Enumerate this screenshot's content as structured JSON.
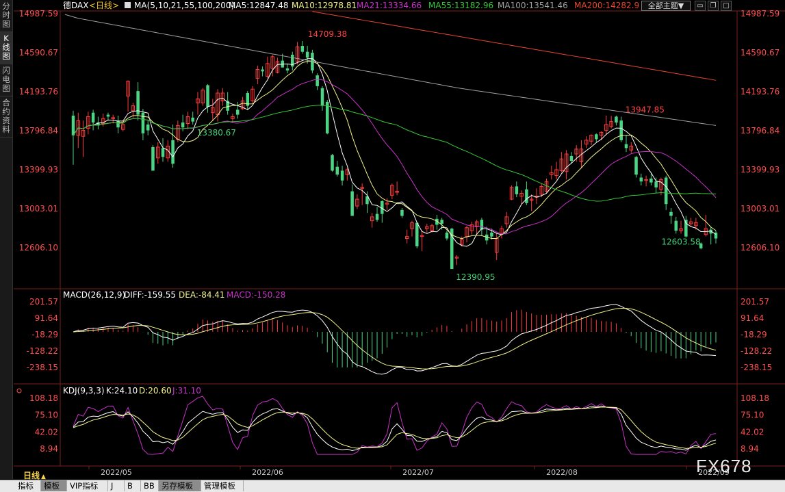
{
  "sidebar": {
    "tabs": [
      {
        "label": "分时图",
        "active": false
      },
      {
        "label": "K线图",
        "active": true
      },
      {
        "label": "闪电图",
        "active": false
      },
      {
        "label": "合约资料",
        "active": false
      }
    ]
  },
  "header": {
    "symbol": "德DAX",
    "period": "<日线>",
    "ma_title": "MA(5,10,21,55,100,200)",
    "ma5": "MA5:12847.48",
    "ma10": "MA10:12978.81",
    "ma21": "MA21:13334.66",
    "ma55": "MA55:13182.96",
    "ma100": "MA100:13541.46",
    "ma200": "MA200:14282.9",
    "theme_button": "全部主题▼",
    "colors": {
      "ma5": "#ffffff",
      "ma10": "#f4f48c",
      "ma21": "#c832c8",
      "ma55": "#36c836",
      "ma100": "#a0a0a0",
      "ma200": "#e8462d"
    }
  },
  "price_axis": [
    "14987.59",
    "14590.67",
    "14193.76",
    "13796.84",
    "13399.93",
    "13003.01",
    "12606.10"
  ],
  "annotations": [
    {
      "text": "14709.38",
      "color": "#ff4444"
    },
    {
      "text": "13380.67",
      "color": "#46d278"
    },
    {
      "text": "12390.95",
      "color": "#46d278"
    },
    {
      "text": "13947.85",
      "color": "#ff4444"
    },
    {
      "text": "12603.58",
      "color": "#46d278"
    }
  ],
  "macd": {
    "title": "MACD(26,12,9)",
    "diff": "DIFF:-159.55",
    "dea": "DEA:-84.41",
    "macd": "MACD:-150.28",
    "axis": [
      "201.57",
      "91.64",
      "-18.29",
      "-128.22",
      "-238.15"
    ]
  },
  "kdj": {
    "title": "KDJ(9,3,3)",
    "k": "K:24.10",
    "d": "D:20.60",
    "j": "J:31.10",
    "axis": [
      "108.18",
      "75.10",
      "42.02",
      "8.94"
    ]
  },
  "x_axis": [
    "2022/05",
    "2022/06",
    "2022/07",
    "2022/08",
    "2022/09"
  ],
  "period_selector": "日线",
  "watermark": "FX678",
  "toolbar": [
    "指标",
    "模板",
    "VIP指标",
    "J",
    "B",
    "BB",
    "另存模板",
    "管理模板"
  ],
  "toolbar_active": "模板",
  "chart_data": {
    "type": "candlestick",
    "candles": [
      [
        13950,
        13750,
        14000,
        13450
      ],
      [
        13750,
        13900,
        13980,
        13620
      ],
      [
        13740,
        13800,
        13900,
        13530
      ],
      [
        13820,
        13940,
        13990,
        13760
      ],
      [
        13980,
        13880,
        14010,
        13800
      ],
      [
        13880,
        13850,
        13940,
        13810
      ],
      [
        13870,
        13920,
        13970,
        13840
      ],
      [
        13960,
        13940,
        13980,
        13900
      ],
      [
        13920,
        13930,
        13960,
        13870
      ],
      [
        13900,
        13830,
        13950,
        13770
      ],
      [
        13810,
        13860,
        13900,
        13790
      ],
      [
        14150,
        14300,
        14310,
        13990
      ],
      [
        14000,
        14050,
        14080,
        13930
      ],
      [
        14200,
        13960,
        14290,
        13900
      ],
      [
        13980,
        13770,
        14020,
        13700
      ],
      [
        13860,
        13800,
        13900,
        13750
      ],
      [
        13630,
        13390,
        13650,
        13390
      ],
      [
        13520,
        13630,
        13680,
        13460
      ],
      [
        13620,
        13530,
        13720,
        13480
      ],
      [
        13520,
        13640,
        13700,
        13480
      ],
      [
        13700,
        13460,
        13860,
        13420
      ],
      [
        13710,
        13850,
        13900,
        13680
      ],
      [
        13880,
        13830,
        13960,
        13790
      ],
      [
        13870,
        13940,
        13990,
        13810
      ],
      [
        13930,
        13890,
        13990,
        13860
      ],
      [
        14080,
        14120,
        14190,
        13960
      ],
      [
        14080,
        14210,
        14230,
        14050
      ],
      [
        14260,
        14040,
        14270,
        13980
      ],
      [
        13980,
        14030,
        14120,
        13900
      ],
      [
        13960,
        14180,
        14220,
        13890
      ],
      [
        14100,
        14180,
        14230,
        14050
      ],
      [
        14100,
        14000,
        14190,
        13960
      ],
      [
        13920,
        13940,
        13970,
        13880
      ],
      [
        14010,
        13960,
        14090,
        13920
      ],
      [
        14020,
        14100,
        14140,
        14010
      ],
      [
        14180,
        14050,
        14200,
        14010
      ],
      [
        14100,
        14220,
        14250,
        14080
      ],
      [
        14330,
        14420,
        14460,
        14270
      ],
      [
        14420,
        14400,
        14450,
        14350
      ],
      [
        14350,
        14480,
        14550,
        14330
      ],
      [
        14430,
        14550,
        14570,
        14350
      ],
      [
        14390,
        14500,
        14540,
        14380
      ],
      [
        14510,
        14440,
        14580,
        14440
      ],
      [
        14430,
        14410,
        14480,
        14380
      ],
      [
        14570,
        14450,
        14600,
        14410
      ],
      [
        14500,
        14650,
        14700,
        14470
      ],
      [
        14660,
        14600,
        14709,
        14580
      ],
      [
        14600,
        14540,
        14660,
        14480
      ],
      [
        14590,
        14410,
        14620,
        14380
      ],
      [
        14360,
        14250,
        14380,
        14210
      ],
      [
        14230,
        14050,
        14250,
        14000
      ],
      [
        14090,
        13770,
        14110,
        13760
      ],
      [
        13550,
        13390,
        13560,
        13380
      ],
      [
        13430,
        13350,
        13490,
        13330
      ],
      [
        13390,
        13290,
        13440,
        13240
      ],
      [
        13350,
        13400,
        13420,
        13290
      ],
      [
        13180,
        12930,
        13250,
        12930
      ],
      [
        13030,
        13100,
        13150,
        13000
      ],
      [
        13210,
        13220,
        13260,
        13040
      ],
      [
        13130,
        13050,
        13180,
        12960
      ],
      [
        12880,
        12920,
        12960,
        12810
      ],
      [
        12950,
        12890,
        13020,
        12870
      ],
      [
        13080,
        12950,
        13090,
        12860
      ],
      [
        13050,
        13060,
        13110,
        12990
      ],
      [
        13140,
        13240,
        13260,
        13100
      ],
      [
        13170,
        13180,
        13280,
        13140
      ],
      [
        12990,
        12930,
        13010,
        12910
      ],
      [
        12700,
        12720,
        12790,
        12650
      ],
      [
        12800,
        12860,
        12880,
        12720
      ],
      [
        12860,
        12620,
        12870,
        12600
      ],
      [
        12720,
        12730,
        12780,
        12570
      ],
      [
        12800,
        12820,
        12850,
        12760
      ],
      [
        12780,
        12830,
        12850,
        12760
      ],
      [
        12900,
        12840,
        12940,
        12790
      ],
      [
        12890,
        12850,
        12910,
        12790
      ],
      [
        12760,
        12700,
        12780,
        12680
      ],
      [
        12800,
        12390,
        12810,
        12390
      ],
      [
        12500,
        12510,
        12530,
        12430
      ],
      [
        12640,
        12690,
        12720,
        12620
      ],
      [
        12720,
        12810,
        12830,
        12660
      ],
      [
        12780,
        12840,
        12870,
        12740
      ],
      [
        12820,
        12870,
        12890,
        12730
      ],
      [
        12890,
        12790,
        12910,
        12730
      ],
      [
        12740,
        12680,
        12820,
        12640
      ],
      [
        12760,
        12720,
        12800,
        12690
      ],
      [
        12560,
        12700,
        12760,
        12480
      ],
      [
        12750,
        12800,
        12830,
        12700
      ],
      [
        12850,
        12920,
        12970,
        12810
      ],
      [
        13100,
        13220,
        13240,
        13090
      ],
      [
        13230,
        13150,
        13280,
        13120
      ],
      [
        13130,
        13160,
        13190,
        13050
      ],
      [
        13200,
        13060,
        13280,
        13040
      ],
      [
        13090,
        13100,
        13150,
        12980
      ],
      [
        13120,
        13130,
        13210,
        13050
      ],
      [
        13150,
        13230,
        13260,
        13120
      ],
      [
        13180,
        13280,
        13310,
        13160
      ],
      [
        13350,
        13370,
        13440,
        13300
      ],
      [
        13340,
        13400,
        13480,
        13300
      ],
      [
        13390,
        13510,
        13580,
        13370
      ],
      [
        13380,
        13560,
        13600,
        13300
      ],
      [
        13540,
        13490,
        13580,
        13460
      ],
      [
        13560,
        13610,
        13650,
        13480
      ],
      [
        13480,
        13610,
        13700,
        13420
      ],
      [
        13660,
        13700,
        13740,
        13620
      ],
      [
        13690,
        13750,
        13760,
        13650
      ],
      [
        13760,
        13710,
        13770,
        13680
      ],
      [
        13750,
        13780,
        13790,
        13700
      ],
      [
        13800,
        13860,
        13950,
        13760
      ],
      [
        13840,
        13890,
        13947,
        13820
      ],
      [
        13940,
        13880,
        13950,
        13850
      ],
      [
        13900,
        13700,
        13940,
        13680
      ],
      [
        13660,
        13620,
        13750,
        13580
      ],
      [
        13600,
        13640,
        13680,
        13570
      ],
      [
        13530,
        13350,
        13540,
        13320
      ],
      [
        13320,
        13280,
        13360,
        13240
      ],
      [
        13290,
        13300,
        13340,
        13230
      ],
      [
        13310,
        13270,
        13360,
        13240
      ],
      [
        13280,
        13220,
        13320,
        13160
      ],
      [
        13200,
        13300,
        13320,
        13140
      ],
      [
        13320,
        13050,
        13340,
        12990
      ],
      [
        12970,
        12930,
        13010,
        12850
      ],
      [
        12880,
        12780,
        12920,
        12750
      ],
      [
        12780,
        12800,
        12880,
        12750
      ],
      [
        12890,
        12720,
        12930,
        12710
      ],
      [
        12850,
        12870,
        12910,
        12820
      ],
      [
        12830,
        12860,
        12910,
        12790
      ],
      [
        12650,
        12600,
        12660,
        12590
      ],
      [
        12740,
        12800,
        12940,
        12720
      ],
      [
        12790,
        12750,
        12820,
        12640
      ],
      [
        12760,
        12700,
        12780,
        12650
      ]
    ]
  }
}
